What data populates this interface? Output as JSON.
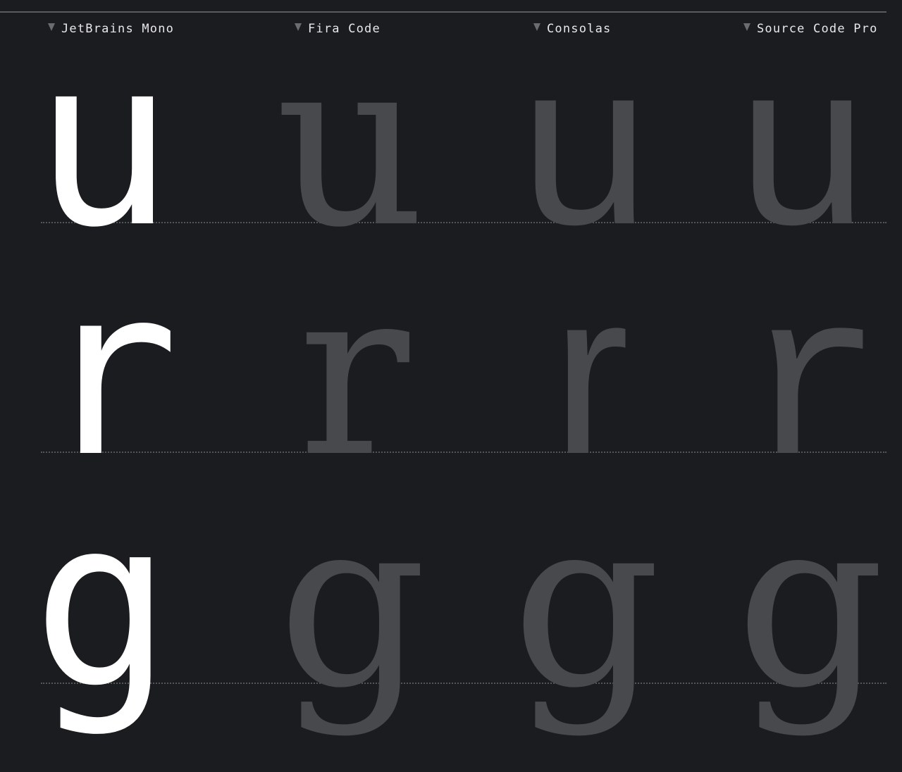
{
  "fonts": [
    {
      "name": "JetBrains Mono",
      "marker_icon": "triangle-down-icon",
      "glyph_color": "#ffffff"
    },
    {
      "name": "Fira Code",
      "marker_icon": "triangle-down-icon",
      "glyph_color": "#48494c"
    },
    {
      "name": "Consolas",
      "marker_icon": "triangle-down-icon",
      "glyph_color": "#48494c"
    },
    {
      "name": "Source Code Pro",
      "marker_icon": "triangle-down-icon",
      "glyph_color": "#48494c"
    }
  ],
  "rows": [
    {
      "letter": "u"
    },
    {
      "letter": "r"
    },
    {
      "letter": "g"
    }
  ],
  "colors": {
    "background": "#1b1c1f",
    "highlight_glyph": "#ffffff",
    "muted_glyph": "#48494c",
    "label_text": "#e8e8ea",
    "baseline_dots": "#55565b"
  }
}
